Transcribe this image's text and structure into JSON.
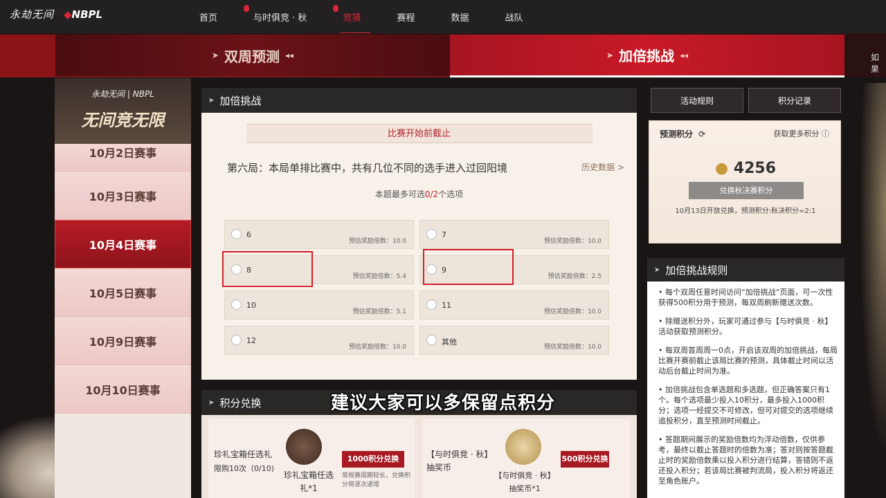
{
  "topnav": {
    "logo_game": "永劫无间",
    "logo_brand": "NBPL",
    "links": [
      {
        "label": "首页"
      },
      {
        "label": "与时俱竞 · 秋"
      },
      {
        "label": "竞猜"
      },
      {
        "label": "赛程"
      },
      {
        "label": "数据"
      },
      {
        "label": "战队"
      }
    ],
    "accent": "#d8263a"
  },
  "banner": {
    "tab_left": "双周预测",
    "tab_right": "加倍挑战",
    "edge_right": "如果"
  },
  "sidebar": {
    "logo_line1": "永劫无间 | NBPL",
    "logo_line2": "无间竞无限",
    "items": [
      {
        "label": "10月2日赛事"
      },
      {
        "label": "10月3日赛事"
      },
      {
        "label": "10月4日赛事"
      },
      {
        "label": "10月5日赛事"
      },
      {
        "label": "10月9日赛事"
      },
      {
        "label": "10月10日赛事"
      }
    ],
    "active_index": 2
  },
  "main": {
    "title": "加倍挑战",
    "deadline": "比赛开始前截止",
    "question": "第六局：本局单排比赛中，共有几位不同的选手进入过回阳境",
    "history_link": "历史数据 >",
    "limit_prefix": "本题最多可选",
    "limit_count": "0/2",
    "limit_suffix": "个选项",
    "odds_label": "预估奖励倍数：",
    "options": [
      {
        "value": "6",
        "odds": "10.0"
      },
      {
        "value": "7",
        "odds": "10.0"
      },
      {
        "value": "8",
        "odds": "5.4"
      },
      {
        "value": "9",
        "odds": "2.5"
      },
      {
        "value": "10",
        "odds": "5.1"
      },
      {
        "value": "11",
        "odds": "10.0"
      },
      {
        "value": "12",
        "odds": "10.0"
      },
      {
        "value": "其他",
        "odds": "10.0"
      }
    ]
  },
  "exchange": {
    "title": "积分兑换",
    "card1": {
      "name": "珍礼宝箱任选礼",
      "limit": "限购10次（0/10)",
      "item": "珍礼宝箱任选礼*1",
      "button": "1000积分兑换",
      "note": "常规赛周期较长，兑换积分将逐次递增"
    },
    "card2": {
      "name": "【与时俱竞 · 秋】抽奖币",
      "item": "【与时俱竞 · 秋】抽奖币*1",
      "button": "500积分兑换"
    }
  },
  "right": {
    "rules_button": "活动规则",
    "record_button": "积分记录",
    "points_label": "预测积分",
    "more_points": "获取更多积分",
    "points_value": "4256",
    "exchange_button": "兑换秋决赛积分",
    "exchange_note": "10月13日开放兑换，预测积分:秋决积分=2:1"
  },
  "rules": {
    "title": "加倍挑战规则",
    "items": [
      "• 每个双周任意时间访问“加倍挑战”页面，可一次性获得500积分用于预测，每双周刷新赠送次数。",
      "• 除赠送积分外，玩家可通过参与【与时俱竞 · 秋】活动获取预测积分。",
      "• 每双周首周周一0点，开启该双周的加倍挑战，每局比赛开赛前截止该局比赛的预测，具体截止时间以活动后台截止时间为准。",
      "• 加倍挑战包含单选题和多选题，但正确答案只有1个。每个选项最少投入10积分，最多投入1000积分；选项一经提交不可修改，但可对提交的选项继续追投积分，直至预测时间截止。",
      "• 答题期间展示的奖励倍数均为浮动倍数，仅供参考，最终以截止答题时的倍数为准；答对则按答题截止时的奖励倍数乘以投入积分进行结算，答错则不返还投入积分；若该局比赛被判流局，投入积分将返还至角色账户。"
    ]
  },
  "subtitle": "建议大家可以多保留点积分"
}
